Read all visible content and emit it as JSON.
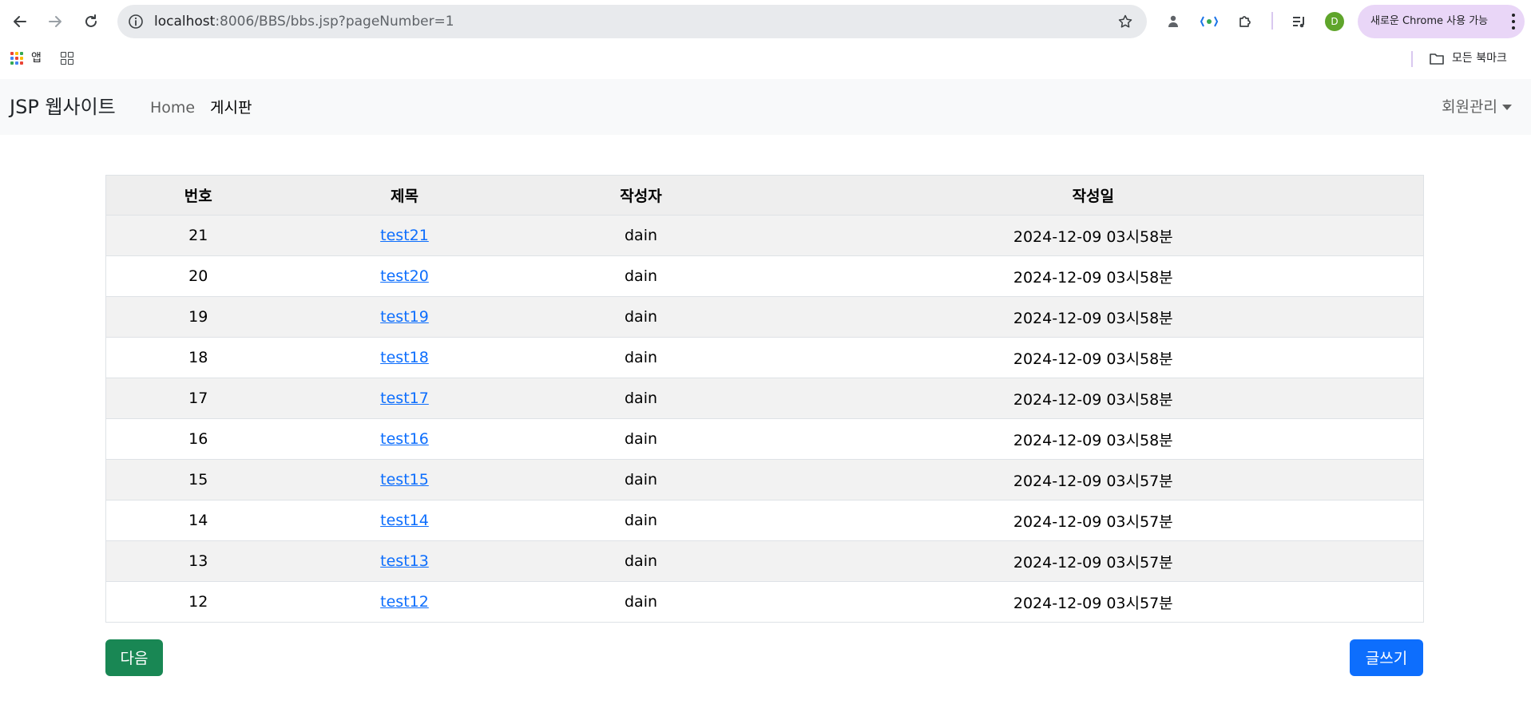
{
  "browser": {
    "url_host": "localhost",
    "url_path": ":8006/BBS/bbs.jsp?pageNumber=1",
    "profile_initial": "D",
    "update_label": "새로운 Chrome 사용 가능",
    "bookmarks": {
      "apps_label": "앱",
      "all_bookmarks_label": "모든 북마크"
    }
  },
  "site": {
    "brand": "JSP 웹사이트",
    "nav": {
      "home": "Home",
      "board": "게시판"
    },
    "member_menu": "회원관리"
  },
  "board": {
    "columns": [
      "번호",
      "제목",
      "작성자",
      "작성일"
    ],
    "rows": [
      {
        "no": "21",
        "title": "test21",
        "author": "dain",
        "date": "2024-12-09 03시58분"
      },
      {
        "no": "20",
        "title": "test20",
        "author": "dain",
        "date": "2024-12-09 03시58분"
      },
      {
        "no": "19",
        "title": "test19",
        "author": "dain",
        "date": "2024-12-09 03시58분"
      },
      {
        "no": "18",
        "title": "test18",
        "author": "dain",
        "date": "2024-12-09 03시58분"
      },
      {
        "no": "17",
        "title": "test17",
        "author": "dain",
        "date": "2024-12-09 03시58분"
      },
      {
        "no": "16",
        "title": "test16",
        "author": "dain",
        "date": "2024-12-09 03시58분"
      },
      {
        "no": "15",
        "title": "test15",
        "author": "dain",
        "date": "2024-12-09 03시57분"
      },
      {
        "no": "14",
        "title": "test14",
        "author": "dain",
        "date": "2024-12-09 03시57분"
      },
      {
        "no": "13",
        "title": "test13",
        "author": "dain",
        "date": "2024-12-09 03시57분"
      },
      {
        "no": "12",
        "title": "test12",
        "author": "dain",
        "date": "2024-12-09 03시57분"
      }
    ]
  },
  "actions": {
    "next_label": "다음",
    "write_label": "글쓰기"
  },
  "colors": {
    "next_button": "#198754",
    "write_button": "#0d6efd",
    "link": "#0d6efd",
    "update_pill": "#e9d6f7"
  }
}
